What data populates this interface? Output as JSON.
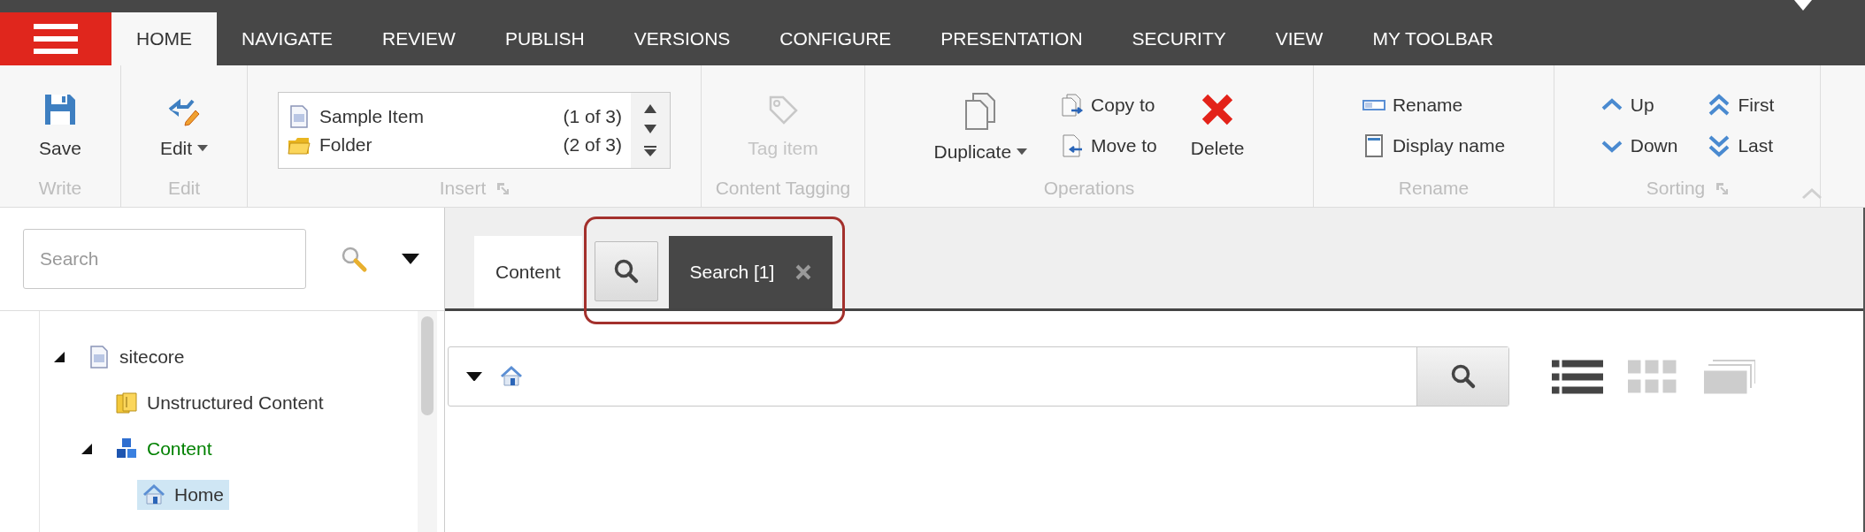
{
  "menu_tabs": [
    {
      "label": "HOME",
      "selected": true
    },
    {
      "label": "NAVIGATE",
      "selected": false
    },
    {
      "label": "REVIEW",
      "selected": false
    },
    {
      "label": "PUBLISH",
      "selected": false
    },
    {
      "label": "VERSIONS",
      "selected": false
    },
    {
      "label": "CONFIGURE",
      "selected": false
    },
    {
      "label": "PRESENTATION",
      "selected": false
    },
    {
      "label": "SECURITY",
      "selected": false
    },
    {
      "label": "VIEW",
      "selected": false
    },
    {
      "label": "MY TOOLBAR",
      "selected": false
    }
  ],
  "ribbon": {
    "groups": [
      {
        "label": "Write",
        "items": [
          {
            "kind": "large",
            "label": "Save",
            "dropdown": false,
            "disabled": false
          }
        ]
      },
      {
        "label": "Edit",
        "items": [
          {
            "kind": "large",
            "label": "Edit",
            "dropdown": true,
            "disabled": false
          }
        ]
      },
      {
        "label": "Insert",
        "launcher": true,
        "items": [
          {
            "kind": "gallery",
            "entries": [
              {
                "label": "Sample Item",
                "count": "(1 of 3)"
              },
              {
                "label": "Folder",
                "count": "(2 of 3)"
              }
            ]
          }
        ]
      },
      {
        "label": "Content Tagging",
        "items": [
          {
            "kind": "large",
            "label": "Tag item",
            "dropdown": false,
            "disabled": true
          }
        ]
      },
      {
        "label": "Operations",
        "items": [
          {
            "kind": "large",
            "label": "Duplicate",
            "dropdown": true,
            "disabled": false
          },
          {
            "kind": "stack",
            "entries": [
              {
                "label": "Copy to"
              },
              {
                "label": "Move to"
              }
            ]
          },
          {
            "kind": "large",
            "label": "Delete",
            "dropdown": false,
            "disabled": false
          }
        ]
      },
      {
        "label": "Rename",
        "items": [
          {
            "kind": "stack",
            "entries": [
              {
                "label": "Rename"
              },
              {
                "label": "Display name"
              }
            ]
          }
        ]
      },
      {
        "label": "Sorting",
        "launcher": true,
        "items": [
          {
            "kind": "stack",
            "entries": [
              {
                "label": "Up"
              },
              {
                "label": "Down"
              }
            ]
          },
          {
            "kind": "stack",
            "entries": [
              {
                "label": "First"
              },
              {
                "label": "Last"
              }
            ]
          }
        ]
      }
    ]
  },
  "tree_search": {
    "placeholder": "Search"
  },
  "tree": [
    {
      "label": "sitecore",
      "expanded": true,
      "selected": false,
      "color": "#333333",
      "children": [
        {
          "label": "Unstructured Content",
          "selected": false,
          "color": "#333333"
        },
        {
          "label": "Content",
          "expanded": true,
          "selected": false,
          "color": "#008000",
          "children": [
            {
              "label": "Home",
              "selected": true,
              "color": "#333333"
            }
          ]
        }
      ]
    }
  ],
  "content_tabs": [
    {
      "kind": "text",
      "label": "Content",
      "selected": false,
      "highlighted": false,
      "closable": false
    },
    {
      "kind": "icon",
      "selected": false,
      "highlighted": true
    },
    {
      "kind": "text",
      "label": "Search [1]",
      "selected": true,
      "highlighted": true,
      "closable": true
    }
  ],
  "view_modes": [
    {
      "selected": true
    },
    {
      "selected": false
    },
    {
      "selected": false
    }
  ]
}
